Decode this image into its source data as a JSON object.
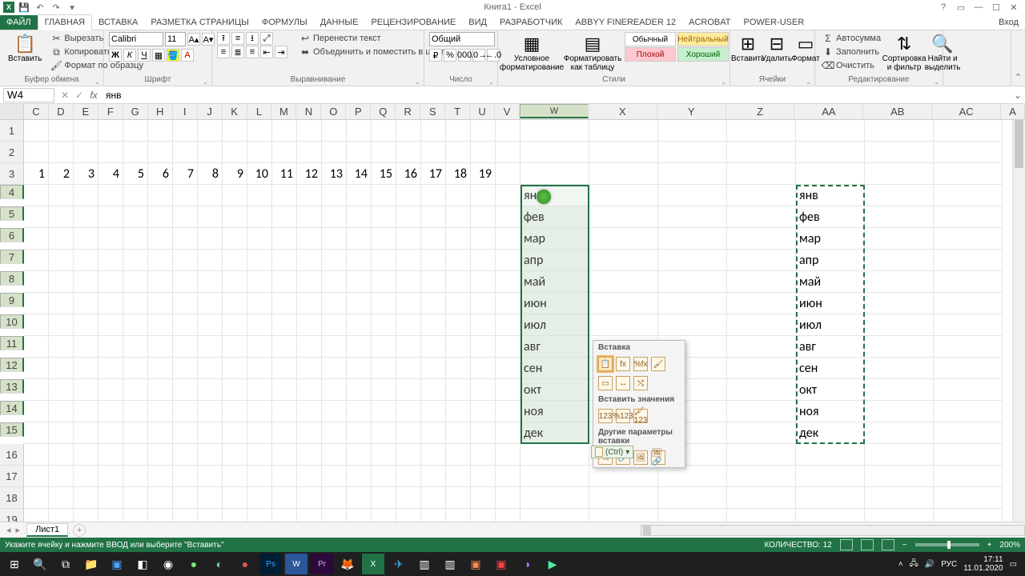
{
  "title": "Книга1 - Excel",
  "login": "Вход",
  "tabs": [
    "ФАЙЛ",
    "ГЛАВНАЯ",
    "ВСТАВКА",
    "РАЗМЕТКА СТРАНИЦЫ",
    "ФОРМУЛЫ",
    "ДАННЫЕ",
    "РЕЦЕНЗИРОВАНИЕ",
    "ВИД",
    "РАЗРАБОТЧИК",
    "ABBYY FineReader 12",
    "ACROBAT",
    "Power-user"
  ],
  "active_tab": 1,
  "ribbon": {
    "clipboard": {
      "paste": "Вставить",
      "cut": "Вырезать",
      "copy": "Копировать",
      "painter": "Формат по образцу",
      "label": "Буфер обмена"
    },
    "font": {
      "name": "Calibri",
      "size": "11",
      "label": "Шрифт"
    },
    "align": {
      "wrap": "Перенести текст",
      "merge": "Объединить и поместить в центре",
      "label": "Выравнивание"
    },
    "number": {
      "format": "Общий",
      "label": "Число"
    },
    "styles": {
      "cond": "Условное форматирование",
      "table": "Форматировать как таблицу",
      "normal": "Обычный",
      "neutral": "Нейтральный",
      "bad": "Плохой",
      "good": "Хороший",
      "label": "Стили"
    },
    "cells": {
      "insert": "Вставить",
      "delete": "Удалить",
      "format": "Формат",
      "label": "Ячейки"
    },
    "editing": {
      "sum": "Автосумма",
      "fill": "Заполнить",
      "clear": "Очистить",
      "sort": "Сортировка и фильтр",
      "find": "Найти и выделить",
      "label": "Редактирование"
    }
  },
  "namebox": "W4",
  "formula": "янв",
  "columns_narrow": [
    "C",
    "D",
    "E",
    "F",
    "G",
    "H",
    "I",
    "J",
    "K",
    "L",
    "M",
    "N",
    "O",
    "P",
    "Q",
    "R",
    "S",
    "T",
    "U",
    "V"
  ],
  "col_W": "W",
  "columns_wide": [
    "X",
    "Y",
    "Z",
    "AA",
    "AB",
    "AC"
  ],
  "col_last": "A",
  "row3_numbers": [
    "1",
    "2",
    "3",
    "4",
    "5",
    "6",
    "7",
    "8",
    "9",
    "10",
    "11",
    "12",
    "13",
    "14",
    "15",
    "16",
    "17",
    "18",
    "19"
  ],
  "months": [
    "янв",
    "фев",
    "мар",
    "апр",
    "май",
    "июн",
    "июл",
    "авг",
    "сен",
    "окт",
    "ноя",
    "дек"
  ],
  "paste_popup": {
    "h1": "Вставка",
    "h2": "Вставить значения",
    "h3": "Другие параметры вставки",
    "ctrl": "(Ctrl)"
  },
  "sheet": {
    "name": "Лист1"
  },
  "status": {
    "msg": "Укажите ячейку и нажмите ВВОД или выберите \"Вставить\"",
    "count_label": "КОЛИЧЕСТВО:",
    "count": "12",
    "zoom": "200%"
  },
  "tray": {
    "lang": "РУС",
    "time": "17:11",
    "date": "11.01.2020"
  }
}
